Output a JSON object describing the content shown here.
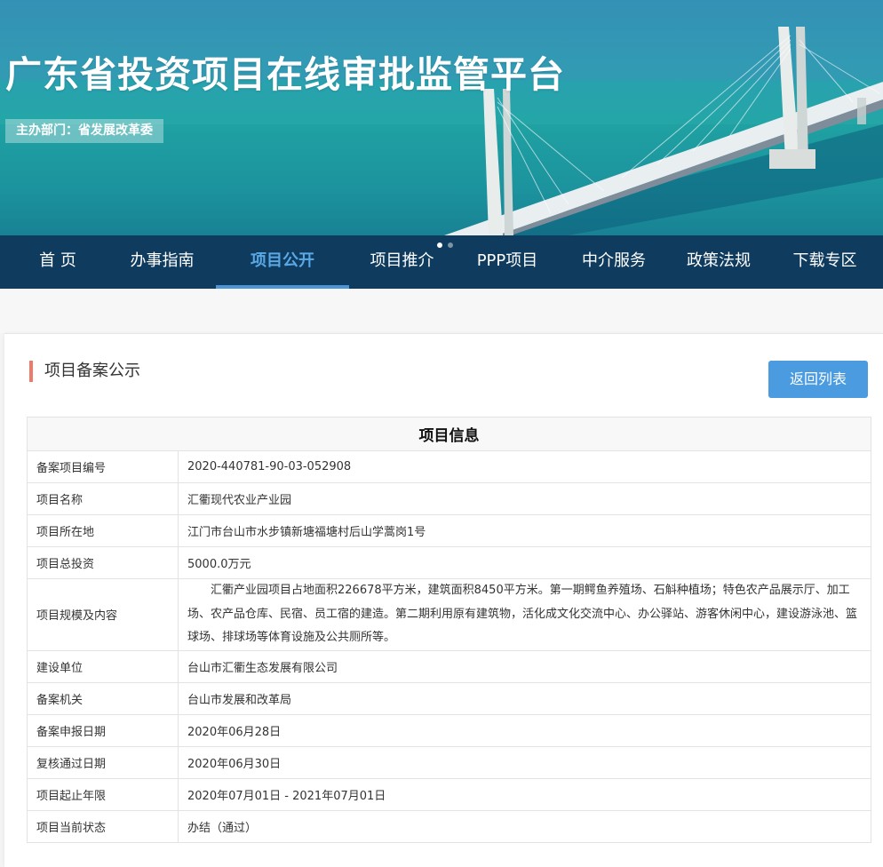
{
  "banner": {
    "title": "广东省投资项目在线审批监管平台",
    "sponsor": "主办部门：省发展改革委",
    "active_slide": 1,
    "slide_count": 2
  },
  "nav": {
    "items": [
      {
        "label": "首 页"
      },
      {
        "label": "办事指南"
      },
      {
        "label": "项目公开",
        "active": true
      },
      {
        "label": "项目推介"
      },
      {
        "label": "PPP项目"
      },
      {
        "label": "中介服务"
      },
      {
        "label": "政策法规"
      },
      {
        "label": "下载专区"
      }
    ]
  },
  "main": {
    "section_title": "项目备案公示",
    "back_label": "返回列表",
    "table_title": "项目信息",
    "rows": [
      {
        "label": "备案项目编号",
        "value": "2020-440781-90-03-052908"
      },
      {
        "label": "项目名称",
        "value": "汇衢现代农业产业园"
      },
      {
        "label": "项目所在地",
        "value": "江门市台山市水步镇新塘福塘村后山学蒿岗1号"
      },
      {
        "label": "项目总投资",
        "value": "5000.0万元"
      },
      {
        "label": "项目规模及内容",
        "value": "汇衢产业园项目占地面积226678平方米，建筑面积8450平方米。第一期鳄鱼养殖场、石斛种植场；特色农产品展示厅、加工场、农产品仓库、民宿、员工宿的建造。第二期利用原有建筑物，活化成文化交流中心、办公驿站、游客休闲中心，建设游泳池、篮球场、排球场等体育设施及公共厕所等。"
      },
      {
        "label": "建设单位",
        "value": "台山市汇衢生态发展有限公司"
      },
      {
        "label": "备案机关",
        "value": "台山市发展和改革局"
      },
      {
        "label": "备案申报日期",
        "value": "2020年06月28日"
      },
      {
        "label": "复核通过日期",
        "value": "2020年06月30日"
      },
      {
        "label": "项目起止年限",
        "value": "2020年07月01日 - 2021年07月01日"
      },
      {
        "label": "项目当前状态",
        "value": "办结（通过）"
      }
    ]
  }
}
